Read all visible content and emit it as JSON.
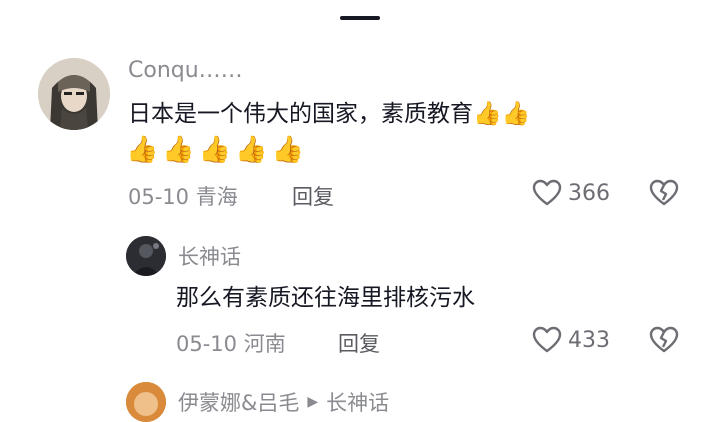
{
  "comments": [
    {
      "username": "Conqu……",
      "text": "日本是一个伟大的国家，素质教育👍👍",
      "thumbs": [
        "👍",
        "👍",
        "👍",
        "👍",
        "👍"
      ],
      "meta": "05-10 青海",
      "reply_label": "回复",
      "likes": "366"
    },
    {
      "username": "长神话",
      "text": "那么有素质还往海里排核污水",
      "meta": "05-10 河南",
      "reply_label": "回复",
      "likes": "433"
    },
    {
      "username": "伊蒙娜&吕毛",
      "reply_to": "长神话"
    }
  ]
}
